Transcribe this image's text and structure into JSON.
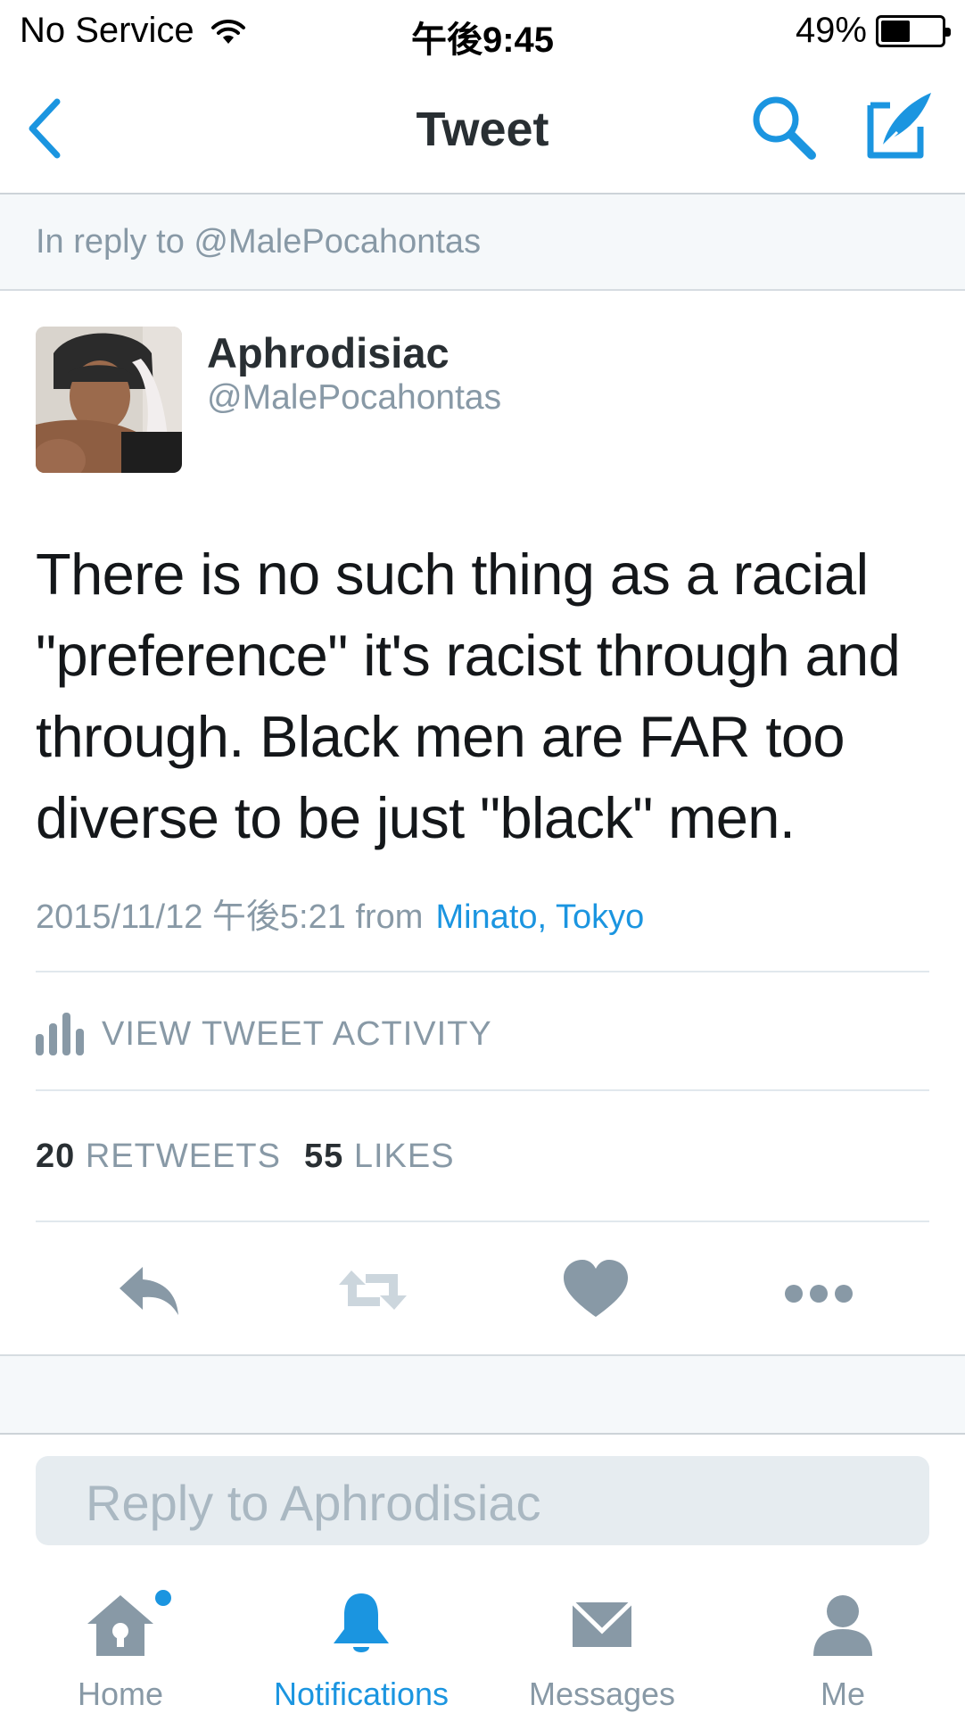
{
  "status_bar": {
    "carrier": "No Service",
    "time": "午後9:45",
    "battery_percent": "49%",
    "battery_level": 0.49
  },
  "nav": {
    "title": "Tweet",
    "back_icon": "chevron-left-icon",
    "search_icon": "search-icon",
    "compose_icon": "compose-tweet-icon"
  },
  "reply_context": {
    "text": "In reply to @MalePocahontas"
  },
  "tweet": {
    "author_name": "Aphrodisiac",
    "author_handle": "@MalePocahontas",
    "text": "There is no such thing as a racial \"preference\" it's racist through and through. Black men are FAR too diverse to be just \"black\" men.",
    "timestamp": "2015/11/12 午後5:21 from",
    "location": "Minato, Tokyo"
  },
  "activity": {
    "label": "VIEW TWEET ACTIVITY"
  },
  "stats": {
    "retweets_count": "20",
    "retweets_label": "RETWEETS",
    "likes_count": "55",
    "likes_label": "LIKES"
  },
  "actions": [
    "reply-icon",
    "retweet-icon",
    "like-icon",
    "more-icon"
  ],
  "reply_box": {
    "placeholder": "Reply to Aphrodisiac"
  },
  "tab_bar": {
    "items": [
      {
        "label": "Home",
        "icon": "home-icon",
        "active": false,
        "has_dot": true
      },
      {
        "label": "Notifications",
        "icon": "bell-icon",
        "active": true
      },
      {
        "label": "Messages",
        "icon": "envelope-icon",
        "active": false
      },
      {
        "label": "Me",
        "icon": "person-icon",
        "active": false
      }
    ]
  },
  "colors": {
    "accent": "#1b95e0",
    "secondary_text": "#8899a6",
    "action_icon": "#8899a6",
    "retweet_disabled": "#ccd6dd"
  }
}
